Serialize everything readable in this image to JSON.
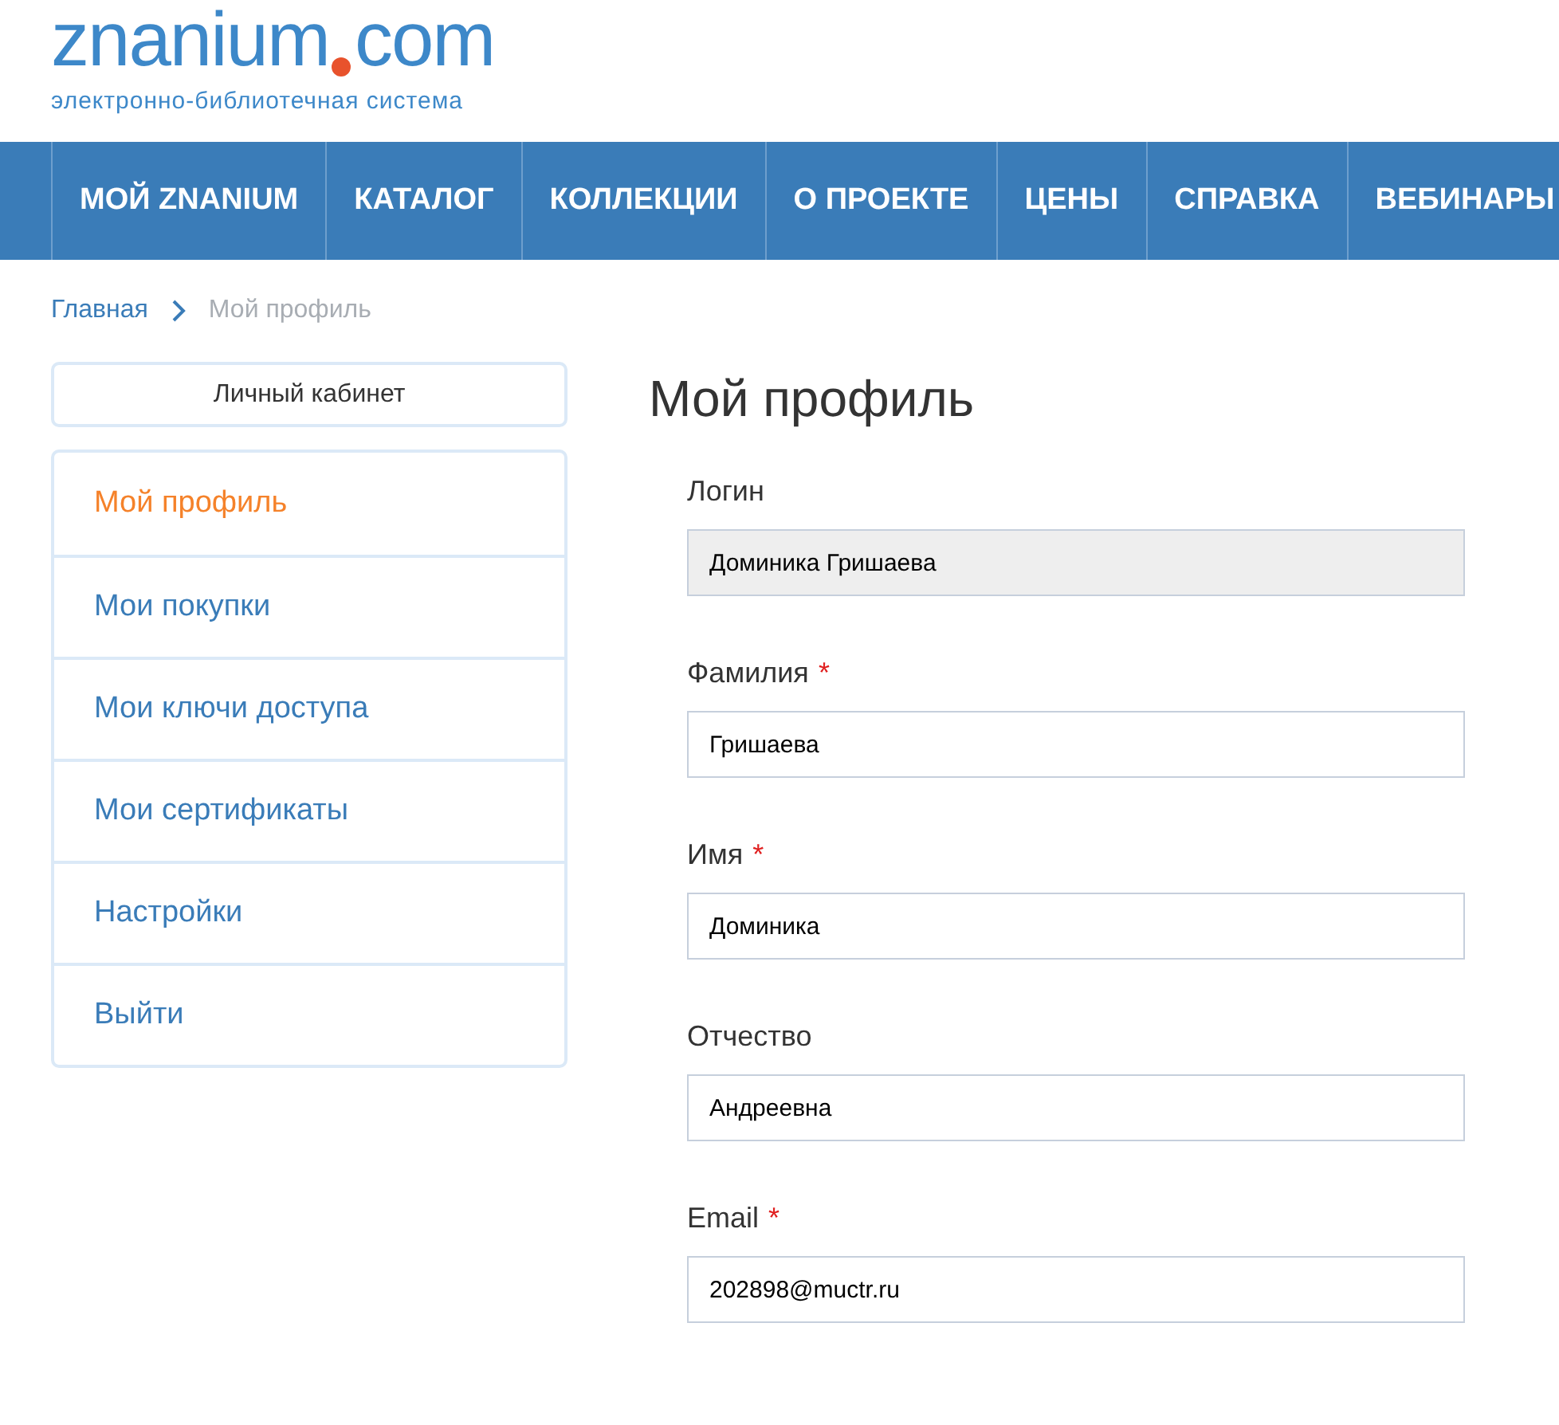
{
  "logo": {
    "name": "znanium",
    "tld": "com",
    "tagline": "электронно-библиотечная система"
  },
  "nav": [
    {
      "label": "МОЙ ZNANIUM"
    },
    {
      "label": "КАТАЛОГ"
    },
    {
      "label": "КОЛЛЕКЦИИ"
    },
    {
      "label": "О ПРОЕКТЕ"
    },
    {
      "label": "ЦЕНЫ"
    },
    {
      "label": "СПРАВКА"
    },
    {
      "label": "ВЕБИНАРЫ"
    }
  ],
  "breadcrumb": [
    {
      "label": "Главная",
      "current": false
    },
    {
      "label": "Мой профиль",
      "current": true
    }
  ],
  "sidebar": {
    "header": "Личный кабинет",
    "items": [
      {
        "label": "Мой профиль",
        "selected": true
      },
      {
        "label": "Мои покупки",
        "selected": false
      },
      {
        "label": "Мои ключи доступа",
        "selected": false
      },
      {
        "label": "Мои сертификаты",
        "selected": false
      },
      {
        "label": "Настройки",
        "selected": false
      },
      {
        "label": "Выйти",
        "selected": false
      }
    ]
  },
  "form": {
    "title": "Мой профиль",
    "fields": [
      {
        "label": "Логин",
        "value": "Доминика Гришаева",
        "disabled": true
      },
      {
        "label": "Фамилия",
        "required_mark": "*",
        "value": "Гришаева",
        "disabled": false
      },
      {
        "label": "Имя",
        "required_mark": "*",
        "value": "Доминика",
        "disabled": false
      },
      {
        "label": "Отчество",
        "value": "Андреевна",
        "disabled": false
      },
      {
        "label": "Email",
        "required_mark": "*",
        "value": "202898@muctr.ru",
        "disabled": false
      }
    ]
  }
}
